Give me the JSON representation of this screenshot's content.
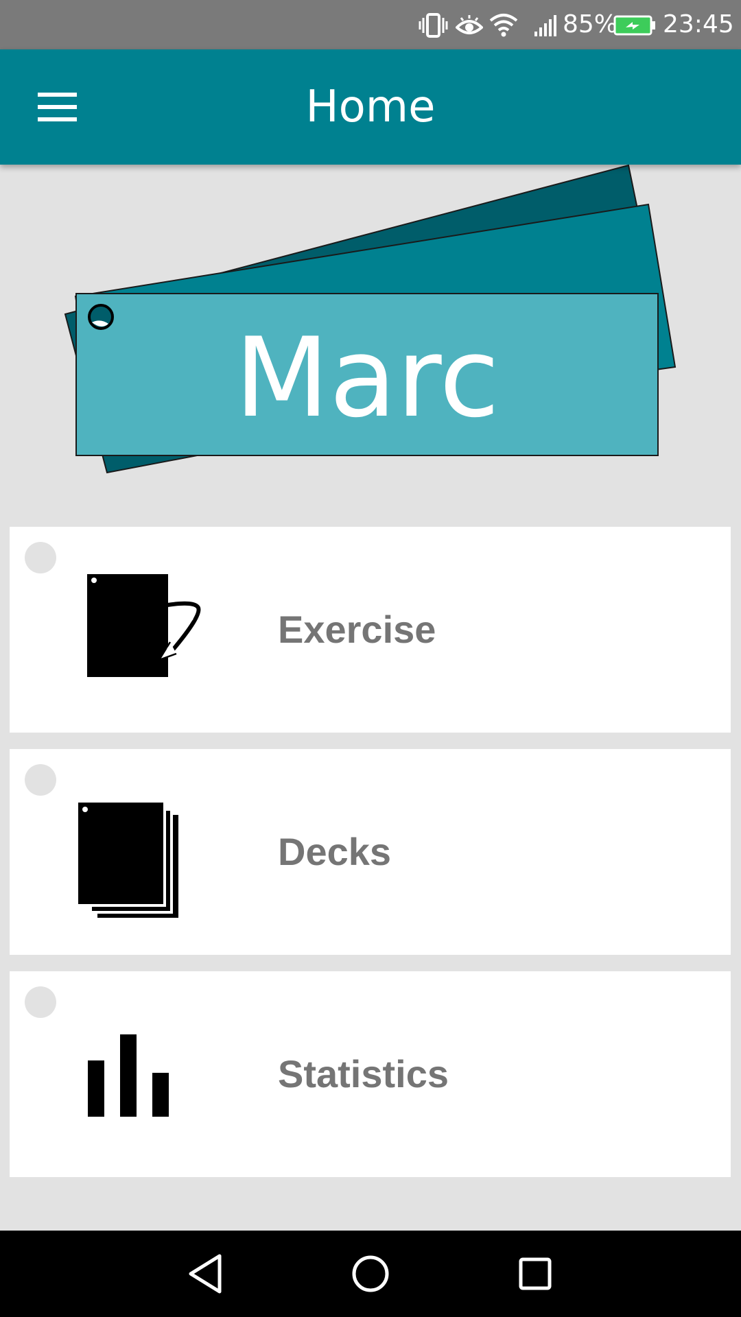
{
  "status_bar": {
    "battery_percent": "85%",
    "time": "23:45",
    "icons": [
      "vibrate-icon",
      "eye-comfort-icon",
      "wifi-icon",
      "signal-icon",
      "battery-charging-icon"
    ]
  },
  "app_bar": {
    "title": "Home",
    "menu_icon": "hamburger-menu-icon"
  },
  "logo": {
    "text": "Marc",
    "colors": {
      "back_card": "#005d6a",
      "middle_card": "#008190",
      "front_card": "#4fb3bf"
    }
  },
  "menu": {
    "items": [
      {
        "label": "Exercise",
        "icon": "flip-card-icon"
      },
      {
        "label": "Decks",
        "icon": "card-stack-icon"
      },
      {
        "label": "Statistics",
        "icon": "bar-chart-icon"
      }
    ]
  },
  "nav_bar": {
    "buttons": [
      "back-icon",
      "home-icon",
      "recents-icon"
    ]
  },
  "colors": {
    "primary": "#008190",
    "background": "#e2e2e2",
    "label_text": "#757575",
    "status_bar": "#7a7a7a"
  }
}
